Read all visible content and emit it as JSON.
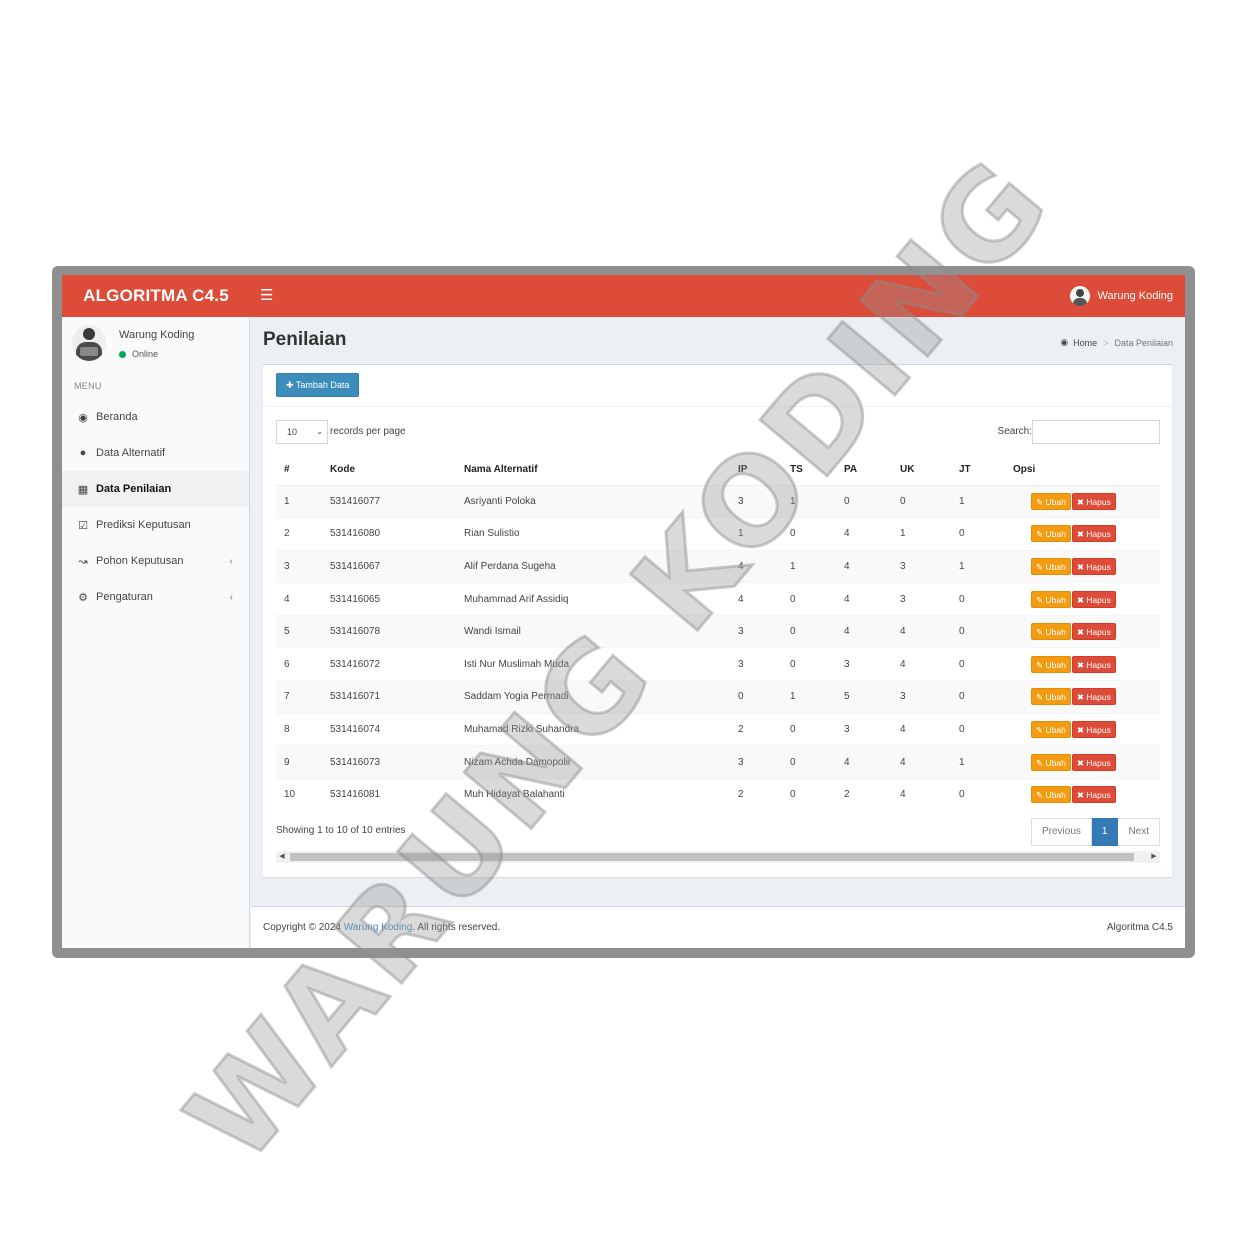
{
  "header": {
    "brand": "ALGORITMA C4.5",
    "menu_icon": "hamburger-icon",
    "user_name": "Warung Koding",
    "accent_color": "#dd4b39"
  },
  "sidebar": {
    "user_name": "Warung Koding",
    "status": "Online",
    "menu_header": "MENU",
    "items": [
      {
        "label": "Beranda",
        "icon": "dashboard-icon"
      },
      {
        "label": "Data Alternatif",
        "icon": "users-icon"
      },
      {
        "label": "Data Penilaian",
        "icon": "grid-icon",
        "active": true
      },
      {
        "label": "Prediksi Keputusan",
        "icon": "check-square-icon"
      },
      {
        "label": "Pohon Keputusan",
        "icon": "line-chart-icon"
      },
      {
        "label": "Pengaturan",
        "icon": "cogs-icon"
      }
    ]
  },
  "page": {
    "title": "Penilaian",
    "breadcrumb": {
      "home": "Home",
      "current": "Data Penilaian"
    },
    "add_button": "Tambah Data",
    "length_value": "10",
    "length_label": "records per page",
    "search_label": "Search:"
  },
  "table": {
    "columns": [
      "#",
      "Kode",
      "Nama Alternatif",
      "IP",
      "TS",
      "PA",
      "UK",
      "JT",
      "Opsi"
    ],
    "edit_label": "Ubah",
    "delete_label": "Hapus",
    "rows": [
      [
        "1",
        "531416077",
        "Asriyanti Poloka",
        "3",
        "1",
        "0",
        "0",
        "1"
      ],
      [
        "2",
        "531416080",
        "Rian Sulistio",
        "1",
        "0",
        "4",
        "1",
        "0"
      ],
      [
        "3",
        "531416067",
        "Alif Perdana Sugeha",
        "4",
        "1",
        "4",
        "3",
        "1"
      ],
      [
        "4",
        "531416065",
        "Muhammad Arif Assidiq",
        "4",
        "0",
        "4",
        "3",
        "0"
      ],
      [
        "5",
        "531416078",
        "Wandi Ismail",
        "3",
        "0",
        "4",
        "4",
        "0"
      ],
      [
        "6",
        "531416072",
        "Isti Nur Muslimah Muda",
        "3",
        "0",
        "3",
        "4",
        "0"
      ],
      [
        "7",
        "531416071",
        "Saddam Yogia Permadi",
        "0",
        "1",
        "5",
        "3",
        "0"
      ],
      [
        "8",
        "531416074",
        "Muhamad Rizki Suhandra",
        "2",
        "0",
        "3",
        "4",
        "0"
      ],
      [
        "9",
        "531416073",
        "Nizam Achda Damopolii",
        "3",
        "0",
        "4",
        "4",
        "1"
      ],
      [
        "10",
        "531416081",
        "Muh Hidayat Balahanti",
        "2",
        "0",
        "2",
        "4",
        "0"
      ]
    ]
  },
  "pagination": {
    "info": "Showing 1 to 10 of 10 entries",
    "previous": "Previous",
    "current": "1",
    "next": "Next"
  },
  "footer": {
    "copy_prefix": "Copyright © 2024 ",
    "copy_link": "Warung Koding",
    "copy_suffix": ". All rights reserved.",
    "version": "Algoritma C4.5"
  },
  "watermark": "WARUNG KODING"
}
